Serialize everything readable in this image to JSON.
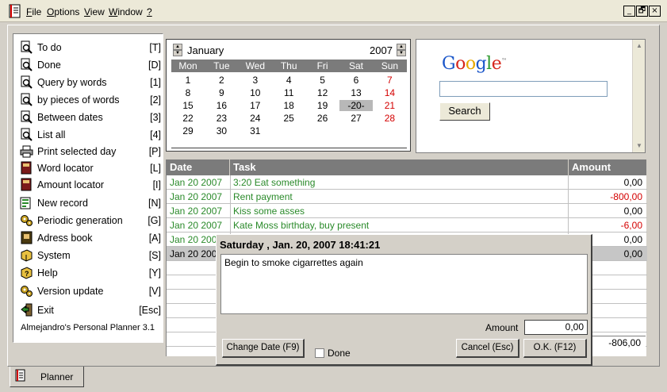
{
  "menubar": {
    "items": [
      "File",
      "Options",
      "View",
      "Window",
      "?"
    ],
    "controls": [
      "_",
      "🗗",
      "×"
    ]
  },
  "nav": {
    "items": [
      {
        "label": "To do",
        "key": "[T]",
        "icon": "magnifier-doc-icon"
      },
      {
        "label": "Done",
        "key": "[D]",
        "icon": "magnifier-doc-icon"
      },
      {
        "label": "Query by words",
        "key": "[1]",
        "icon": "magnifier-doc-icon"
      },
      {
        "label": "by pieces of words",
        "key": "[2]",
        "icon": "magnifier-doc-icon"
      },
      {
        "label": "Between dates",
        "key": "[3]",
        "icon": "magnifier-doc-icon"
      },
      {
        "label": "List all",
        "key": "[4]",
        "icon": "magnifier-doc-icon"
      },
      {
        "label": "Print selected day",
        "key": "[P]",
        "icon": "printer-icon"
      },
      {
        "label": "Word locator",
        "key": "[L]",
        "icon": "book-icon"
      },
      {
        "label": "Amount locator",
        "key": "[I]",
        "icon": "book-icon"
      },
      {
        "label": "New record",
        "key": "[N]",
        "icon": "new-record-icon"
      },
      {
        "label": "Periodic generation",
        "key": "[G]",
        "icon": "gears-icon"
      },
      {
        "label": "Adress book",
        "key": "[A]",
        "icon": "address-book-icon"
      },
      {
        "label": "System",
        "key": "[S]",
        "icon": "system-icon"
      },
      {
        "label": "Help",
        "key": "[Y]",
        "icon": "help-icon"
      },
      {
        "label": "Version update",
        "key": "[V]",
        "icon": "gears-icon"
      },
      {
        "label": "Exit",
        "key": "[Esc]",
        "icon": "exit-icon"
      }
    ],
    "version": "Almejandro's Personal Planner 3.1"
  },
  "calendar": {
    "month": "January",
    "year": "2007",
    "dow": [
      "Mon",
      "Tue",
      "Wed",
      "Thu",
      "Fri",
      "Sat",
      "Sun"
    ],
    "weeks": [
      [
        "1",
        "2",
        "3",
        "4",
        "5",
        "6",
        "7"
      ],
      [
        "8",
        "9",
        "10",
        "11",
        "12",
        "13",
        "14"
      ],
      [
        "15",
        "16",
        "17",
        "18",
        "19",
        "-20-",
        "21"
      ],
      [
        "22",
        "23",
        "24",
        "25",
        "26",
        "27",
        "28"
      ],
      [
        "29",
        "30",
        "31",
        "",
        "",
        "",
        ""
      ]
    ]
  },
  "google": {
    "logo_letters": [
      {
        "ch": "G",
        "color": "#1a56c9"
      },
      {
        "ch": "o",
        "color": "#d6261b"
      },
      {
        "ch": "o",
        "color": "#e8a800"
      },
      {
        "ch": "g",
        "color": "#1a56c9"
      },
      {
        "ch": "l",
        "color": "#2e9a2e"
      },
      {
        "ch": "e",
        "color": "#d6261b"
      }
    ],
    "tm": "™",
    "search_label": "Search"
  },
  "table": {
    "headers": [
      "Date",
      "Task",
      "Amount"
    ],
    "rows": [
      {
        "date": "Jan 20 2007",
        "task": "3:20 Eat something",
        "amount": "0,00",
        "neg": false
      },
      {
        "date": "Jan 20 2007",
        "task": "Rent payment",
        "amount": "-800,00",
        "neg": true
      },
      {
        "date": "Jan 20 2007",
        "task": "Kiss some asses",
        "amount": "0,00",
        "neg": false
      },
      {
        "date": "Jan 20 2007",
        "task": "Kate Moss birthday, buy present",
        "amount": "-6,00",
        "neg": true
      },
      {
        "date": "Jan 20 200",
        "task": "",
        "amount": "0,00",
        "neg": false
      },
      {
        "date": "Jan 20 200",
        "task": "",
        "amount": "0,00",
        "neg": false
      }
    ],
    "total": "-806,00"
  },
  "popup": {
    "title": "Saturday , Jan. 20, 2007 18:41:21",
    "text": "Begin to smoke cigarrettes again",
    "amount_label": "Amount",
    "amount_value": "0,00",
    "change_date_label": "Change Date (F9)",
    "done_label": "Done",
    "cancel_label": "Cancel (Esc)",
    "ok_label": "O.K. (F12)"
  },
  "tabs": {
    "planner_label": "Planner"
  }
}
